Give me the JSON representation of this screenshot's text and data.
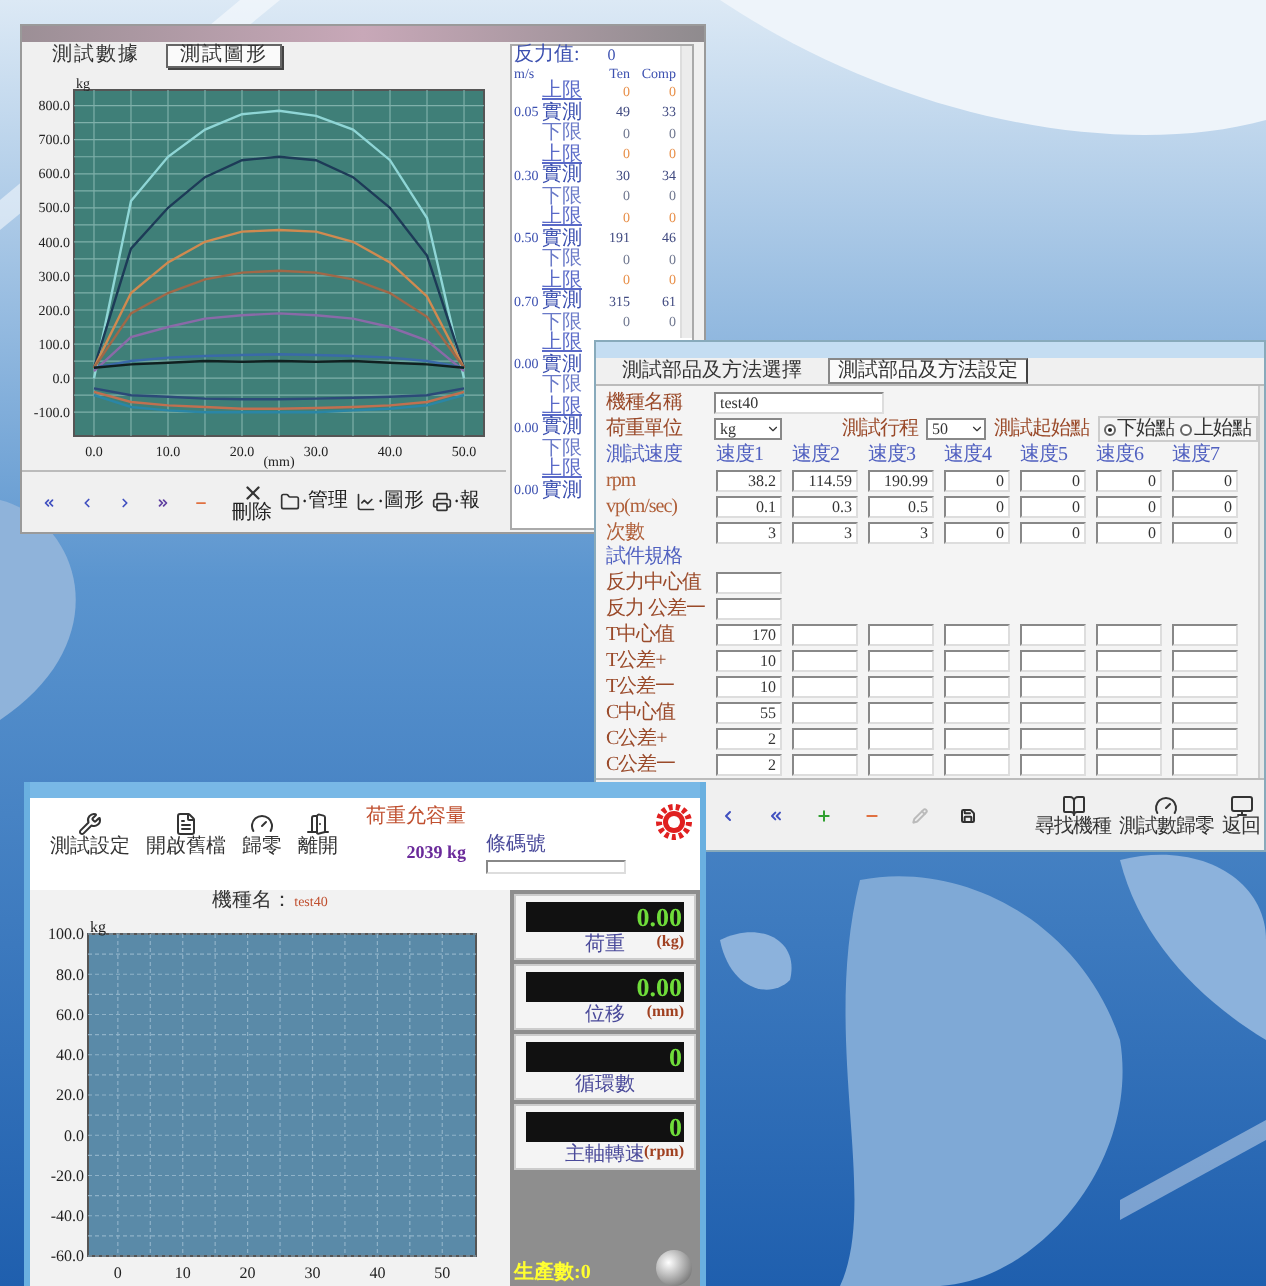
{
  "data_window": {
    "tabs": [
      {
        "label": "測試數據",
        "selected": false
      },
      {
        "label": "測試圖形",
        "selected": true
      }
    ],
    "chart_data": {
      "type": "line",
      "grid": true,
      "ylabel": "kg",
      "xlabel": "(mm)",
      "x": [
        0,
        5,
        10,
        15,
        20,
        25,
        30,
        35,
        40,
        45,
        50
      ],
      "xlim": [
        -2.7,
        52.7
      ],
      "ylim": [
        -170,
        846
      ],
      "xticks": [
        {
          "value": 0,
          "label": "0.0"
        },
        {
          "value": 10,
          "label": "10.0"
        },
        {
          "value": 20,
          "label": "20.0"
        },
        {
          "value": 30,
          "label": "30.0"
        },
        {
          "value": 40,
          "label": "40.0"
        },
        {
          "value": 50,
          "label": "50.0"
        }
      ],
      "yticks": [
        {
          "value": 800,
          "label": "800.0"
        },
        {
          "value": 700,
          "label": "700.0"
        },
        {
          "value": 600,
          "label": "600.0"
        },
        {
          "value": 500,
          "label": "500.0"
        },
        {
          "value": 400,
          "label": "400.0"
        },
        {
          "value": 300,
          "label": "300.0"
        },
        {
          "value": 200,
          "label": "200.0"
        },
        {
          "value": 100,
          "label": "100.0"
        },
        {
          "value": 0,
          "label": "0.0"
        },
        {
          "value": -100,
          "label": "-100.0"
        }
      ],
      "series": [
        {
          "color": "#8fd6d6",
          "values": [
            0,
            520,
            650,
            730,
            775,
            785,
            770,
            730,
            640,
            470,
            0
          ]
        },
        {
          "color": "#1d3b57",
          "values": [
            30,
            380,
            500,
            590,
            640,
            650,
            640,
            590,
            500,
            360,
            30
          ]
        },
        {
          "color": "#d08a50",
          "values": [
            30,
            250,
            340,
            400,
            430,
            435,
            430,
            400,
            340,
            240,
            30
          ]
        },
        {
          "color": "#a06848",
          "values": [
            30,
            190,
            250,
            290,
            310,
            315,
            310,
            290,
            250,
            180,
            30
          ]
        },
        {
          "color": "#8a6aa8",
          "values": [
            20,
            120,
            150,
            175,
            185,
            190,
            185,
            175,
            150,
            110,
            20
          ]
        },
        {
          "color": "#3a6aa8",
          "values": [
            30,
            50,
            60,
            65,
            68,
            70,
            68,
            65,
            60,
            50,
            30
          ]
        },
        {
          "color": "#102020",
          "values": [
            30,
            40,
            45,
            50,
            48,
            50,
            48,
            50,
            45,
            40,
            30
          ]
        },
        {
          "color": "#2c4a78",
          "values": [
            -30,
            -50,
            -55,
            -60,
            -62,
            -62,
            -60,
            -58,
            -55,
            -50,
            -30
          ]
        },
        {
          "color": "#c07050",
          "values": [
            -40,
            -70,
            -80,
            -85,
            -90,
            -90,
            -88,
            -85,
            -80,
            -70,
            -40
          ]
        },
        {
          "color": "#2a86a6",
          "values": [
            -50,
            -85,
            -95,
            -100,
            -100,
            -100,
            -100,
            -95,
            -90,
            -80,
            -50
          ]
        }
      ]
    },
    "reaction": {
      "label": "反力值:",
      "value": "0"
    },
    "columns": [
      "m/s",
      "Ten",
      "Comp"
    ],
    "readings": [
      {
        "kind": "upper",
        "label": "上限",
        "ten": "0",
        "comp": "0"
      },
      {
        "kind": "measured",
        "speed": "0.05",
        "label": "實測",
        "ten": "49",
        "comp": "33"
      },
      {
        "kind": "lower",
        "label": "下限",
        "ten": "0",
        "comp": "0"
      },
      {
        "kind": "upper",
        "label": "上限",
        "ten": "0",
        "comp": "0"
      },
      {
        "kind": "measured",
        "speed": "0.30",
        "label": "實測",
        "ten": "30",
        "comp": "34"
      },
      {
        "kind": "lower",
        "label": "下限",
        "ten": "0",
        "comp": "0"
      },
      {
        "kind": "upper",
        "label": "上限",
        "ten": "0",
        "comp": "0"
      },
      {
        "kind": "measured",
        "speed": "0.50",
        "label": "實測",
        "ten": "191",
        "comp": "46"
      },
      {
        "kind": "lower",
        "label": "下限",
        "ten": "0",
        "comp": "0"
      },
      {
        "kind": "upper",
        "label": "上限",
        "ten": "0",
        "comp": "0"
      },
      {
        "kind": "measured",
        "speed": "0.70",
        "label": "實測",
        "ten": "315",
        "comp": "61"
      },
      {
        "kind": "lower",
        "label": "下限",
        "ten": "0",
        "comp": "0"
      },
      {
        "kind": "upper",
        "label": "上限"
      },
      {
        "kind": "measured",
        "speed": "0.00",
        "label": "實測"
      },
      {
        "kind": "lower",
        "label": "下限"
      },
      {
        "kind": "upper",
        "label": "上限"
      },
      {
        "kind": "measured",
        "speed": "0.00",
        "label": "實測"
      },
      {
        "kind": "lower",
        "label": "下限"
      },
      {
        "kind": "upper",
        "label": "上限"
      },
      {
        "kind": "measured",
        "speed": "0.00",
        "label": "實測"
      }
    ],
    "nav": [
      {
        "kind": "first"
      },
      {
        "kind": "prev"
      },
      {
        "kind": "next"
      },
      {
        "kind": "last"
      },
      {
        "kind": "remove"
      }
    ],
    "delete_label": "刪除",
    "tools": [
      {
        "kind": "manage",
        "label": "‧管理"
      },
      {
        "kind": "graph",
        "label": "‧圖形"
      },
      {
        "kind": "report",
        "label": "‧報"
      }
    ]
  },
  "setup_window": {
    "tabs": [
      {
        "label": "測試部品及方法選擇",
        "selected": false
      },
      {
        "label": "測試部品及方法設定",
        "selected": true
      }
    ],
    "model": {
      "label": "機種名稱",
      "value": "test40"
    },
    "unit": {
      "label": "荷重單位",
      "value": "kg"
    },
    "stroke": {
      "label": "測試行程",
      "value": "50"
    },
    "start": {
      "label": "測試起始點",
      "options": [
        {
          "label": "下始點",
          "selected": true
        },
        {
          "label": "上始點",
          "selected": false
        }
      ]
    },
    "speed_label": "測試速度",
    "speed_headers": [
      "速度1",
      "速度2",
      "速度3",
      "速度4",
      "速度5",
      "速度6",
      "速度7"
    ],
    "speed_rows": [
      {
        "label": "rpm",
        "values": [
          "38.2",
          "114.59",
          "190.99",
          "0",
          "0",
          "0",
          "0"
        ]
      },
      {
        "label": "vp(m/sec)",
        "values": [
          "0.1",
          "0.3",
          "0.5",
          "0",
          "0",
          "0",
          "0"
        ]
      },
      {
        "label": "次數",
        "values": [
          "3",
          "3",
          "3",
          "0",
          "0",
          "0",
          "0"
        ]
      }
    ],
    "spec_label": "試件規格",
    "reaction_rows": [
      {
        "label": "反力中心值"
      },
      {
        "label": "反力 公差一"
      }
    ],
    "spec_rows": [
      {
        "label": "T中心值",
        "values": [
          "170"
        ]
      },
      {
        "label": "T公差+",
        "values": [
          "10"
        ]
      },
      {
        "label": "T公差一",
        "values": [
          "10"
        ]
      },
      {
        "label": "C中心值",
        "values": [
          "55"
        ]
      },
      {
        "label": "C公差+",
        "values": [
          "2"
        ]
      },
      {
        "label": "C公差一",
        "values": [
          "2"
        ]
      }
    ],
    "toolbar": [
      {
        "kind": "prev",
        "disabled": false
      },
      {
        "kind": "first",
        "disabled": false
      },
      {
        "kind": "add",
        "disabled": false
      },
      {
        "kind": "remove",
        "disabled": false
      },
      {
        "kind": "edit",
        "disabled": true
      },
      {
        "kind": "save",
        "disabled": false
      }
    ],
    "actions": [
      {
        "kind": "find",
        "label": "尋找機種"
      },
      {
        "kind": "reset",
        "label": "測試數歸零"
      },
      {
        "kind": "back",
        "label": "返回"
      }
    ]
  },
  "monitor_window": {
    "toolbar": [
      {
        "kind": "setup",
        "label": "測試設定"
      },
      {
        "kind": "open",
        "label": "開啟舊檔"
      },
      {
        "kind": "zero",
        "label": "歸零"
      },
      {
        "kind": "exit",
        "label": "離開"
      }
    ],
    "capacity_label": "荷重允容量",
    "capacity_value": "2039 kg",
    "barcode_label": "條碼號",
    "model_label": "機種名：",
    "model_name": "test40",
    "chart_data": {
      "type": "line",
      "grid": true,
      "ylabel": "kg",
      "xlim": [
        -4.6,
        55.2
      ],
      "ylim": [
        -60,
        100
      ],
      "xticks": [
        0,
        10,
        20,
        30,
        40,
        50
      ],
      "yticks": [
        {
          "value": 100,
          "label": "100.0"
        },
        {
          "value": 80,
          "label": "80.0"
        },
        {
          "value": 60,
          "label": "60.0"
        },
        {
          "value": 40,
          "label": "40.0"
        },
        {
          "value": 20,
          "label": "20.0"
        },
        {
          "value": 0,
          "label": "0.0"
        },
        {
          "value": -20,
          "label": "-20.0"
        },
        {
          "value": -40,
          "label": "-40.0"
        },
        {
          "value": -60,
          "label": "-60.0"
        }
      ]
    },
    "readouts": [
      {
        "value": "0.00",
        "label": "荷重",
        "unit": "(kg)"
      },
      {
        "value": "0.00",
        "label": "位移",
        "unit": "(mm)"
      },
      {
        "value": "0",
        "label": "循環數"
      },
      {
        "value": "0",
        "label": "主軸轉速",
        "unit": "(rpm)"
      }
    ],
    "production": "生產數:0"
  }
}
